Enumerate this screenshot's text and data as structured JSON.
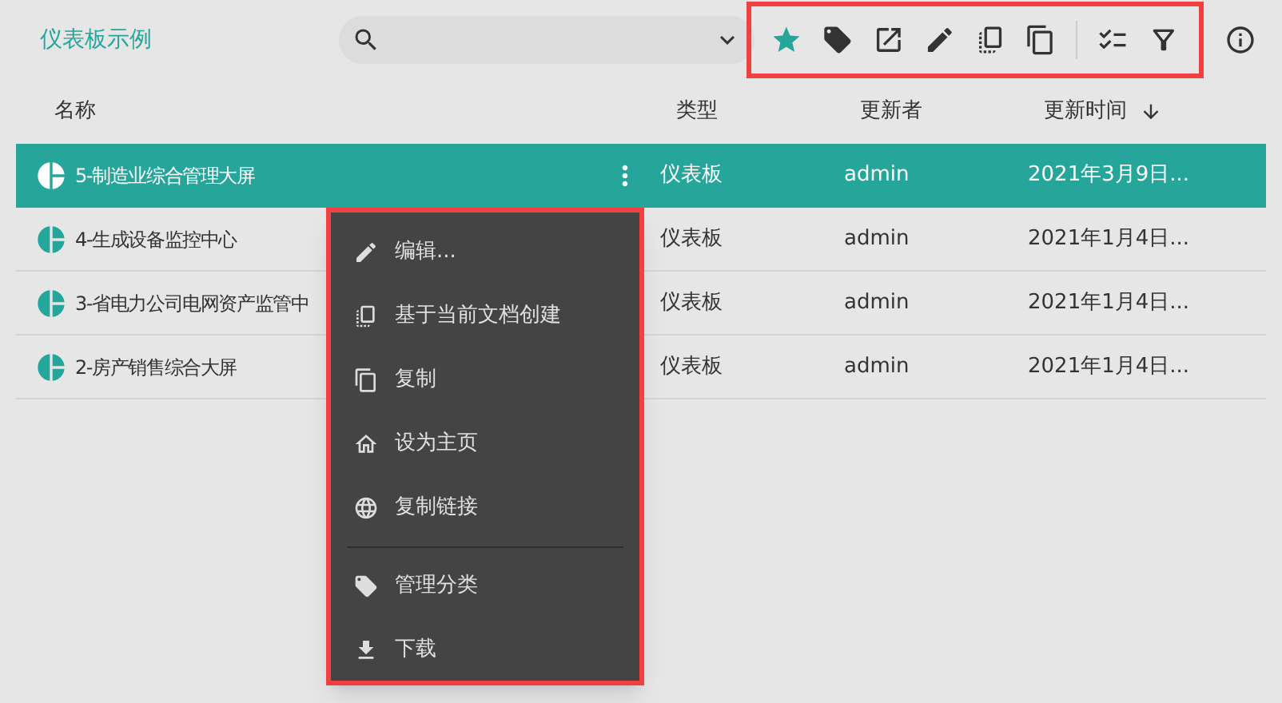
{
  "title": "仪表板示例",
  "toolbar": {
    "favorite_on": true
  },
  "table": {
    "columns": [
      "名称",
      "类型",
      "更新者",
      "更新时间"
    ],
    "sort_arrow": true,
    "rows": [
      {
        "name": "5-制造业综合管理大屏",
        "type": "仪表板",
        "updater": "admin",
        "time": "2021年3月9日...",
        "selected": true
      },
      {
        "name": "4-生成设备监控中心",
        "type": "仪表板",
        "updater": "admin",
        "time": "2021年1月4日...",
        "selected": false
      },
      {
        "name": "3-省电力公司电网资产监管中",
        "type": "仪表板",
        "updater": "admin",
        "time": "2021年1月4日...",
        "selected": false
      },
      {
        "name": "2-房产销售综合大屏",
        "type": "仪表板",
        "updater": "admin",
        "time": "2021年1月4日...",
        "selected": false
      }
    ]
  },
  "context_menu": {
    "groups": [
      [
        "编辑...",
        "基于当前文档创建",
        "复制",
        "设为主页",
        "复制链接"
      ],
      [
        "管理分类",
        "下载"
      ]
    ]
  }
}
